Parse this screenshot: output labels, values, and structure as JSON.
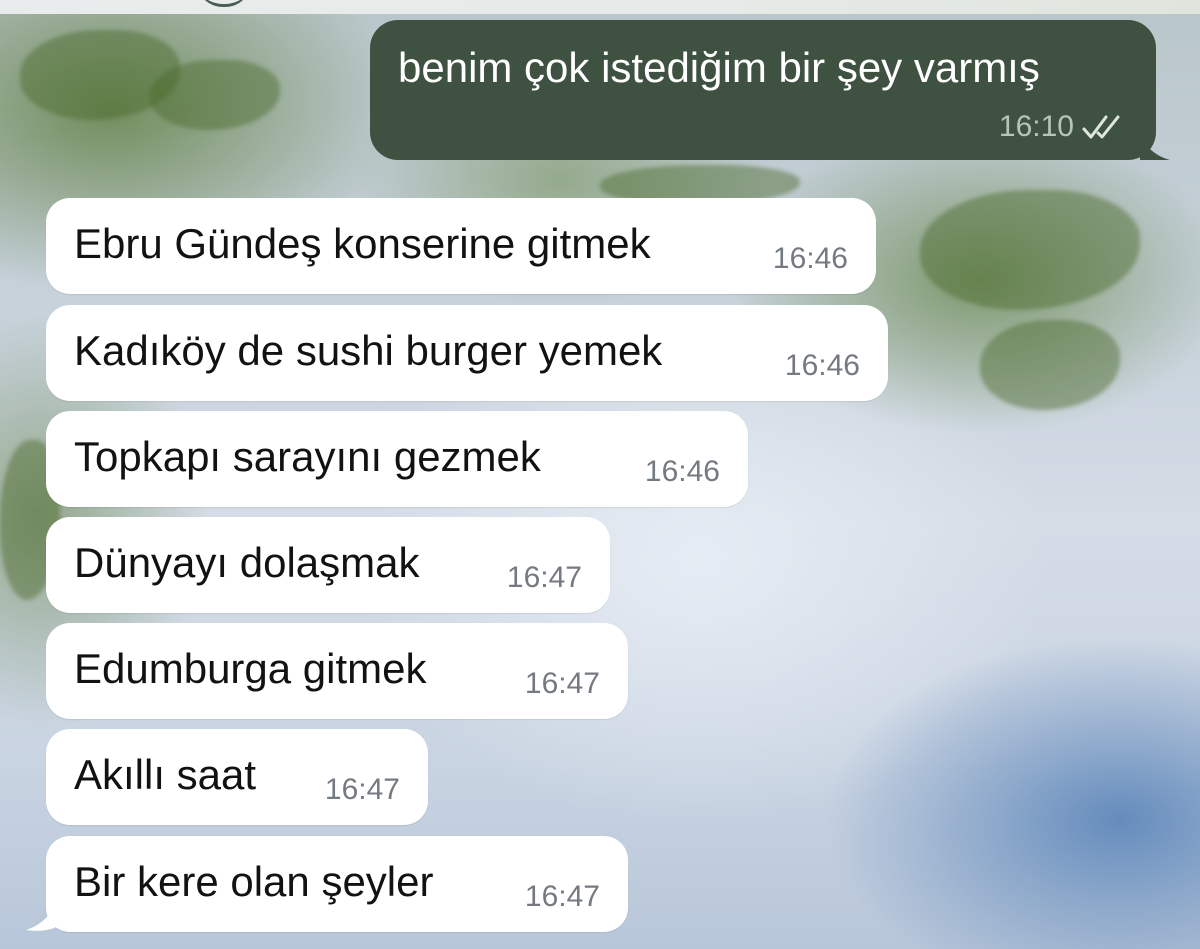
{
  "colors": {
    "outgoing_bubble": "#3f5140",
    "incoming_bubble": "#ffffff",
    "outgoing_text": "#ffffff",
    "incoming_text": "#121212",
    "timestamp_in": "#747a80",
    "timestamp_out": "#b9c4b8"
  },
  "outgoing": {
    "text": "benim çok istediğim bir şey varmış",
    "time": "16:10",
    "status_icon": "double-check-icon"
  },
  "incoming": [
    {
      "text": "Ebru Gündeş konserine gitmek",
      "time": "16:46"
    },
    {
      "text": "Kadıköy de sushi burger yemek",
      "time": "16:46"
    },
    {
      "text": "Topkapı sarayını gezmek",
      "time": "16:46"
    },
    {
      "text": "Dünyayı dolaşmak",
      "time": "16:47"
    },
    {
      "text": "Edumburga gitmek",
      "time": "16:47"
    },
    {
      "text": "Akıllı saat",
      "time": "16:47"
    },
    {
      "text": "Bir kere olan şeyler",
      "time": "16:47"
    }
  ]
}
